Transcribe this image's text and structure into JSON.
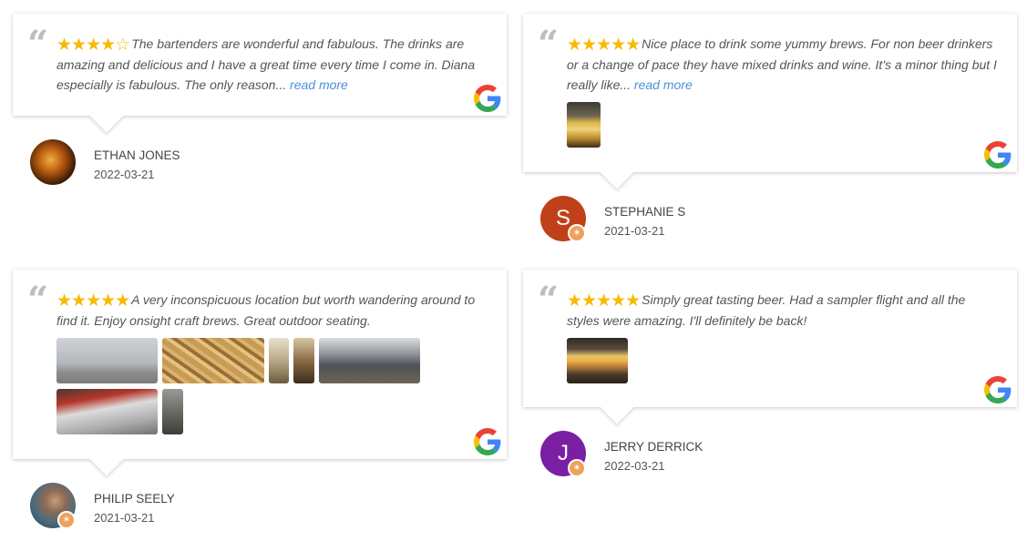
{
  "colors": {
    "star": "#f6bb06",
    "link": "#4a90d9",
    "quote": "#bdbdbd"
  },
  "icons": {
    "quote": "quote-icon",
    "google": "google-logo-icon",
    "badge": "reviewer-badge-icon"
  },
  "reviews": [
    {
      "rating": 4,
      "stars_filled": "★★★★",
      "stars_empty": "☆",
      "text": "The bartenders are wonderful and fabulous. The drinks are amazing and delicious and I have a great time every time I come in. Diana especially is fabulous. The only reason...",
      "read_more": "read more",
      "author": "ETHAN JONES",
      "date": "2022-03-21",
      "photos": 0
    },
    {
      "rating": 5,
      "stars_filled": "★★★★★",
      "text": "Nice place to drink some yummy brews. For non beer drinkers or a change of pace they have mixed drinks and wine. It's a minor thing but I really like...",
      "read_more": "read more",
      "author": "STEPHANIE S",
      "avatar_letter": "S",
      "date": "2021-03-21",
      "photos": 1
    },
    {
      "rating": 5,
      "stars_filled": "★★★★★",
      "text": "A very inconspicuous location but worth wandering around to find it. Enjoy onsight craft brews. Great outdoor seating.",
      "author": "PHILIP SEELY",
      "date": "2021-03-21",
      "photos": 7
    },
    {
      "rating": 5,
      "stars_filled": "★★★★★",
      "text": "Simply great tasting beer. Had a sampler flight and all the styles were amazing. I'll definitely be back!",
      "author": "JERRY DERRICK",
      "avatar_letter": "J",
      "date": "2022-03-21",
      "photos": 1
    }
  ]
}
